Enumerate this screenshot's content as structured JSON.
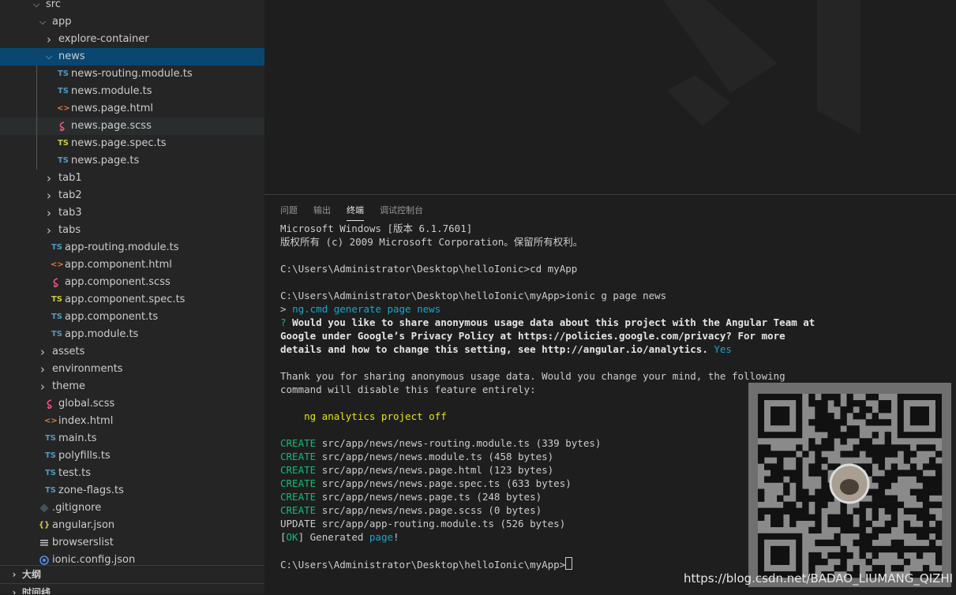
{
  "explorer": {
    "items": [
      {
        "label": "src",
        "type": "folder-open"
      },
      {
        "label": "app",
        "type": "folder-open"
      },
      {
        "label": "explore-container",
        "type": "folder"
      },
      {
        "label": "news",
        "type": "folder-open"
      },
      {
        "label": "news-routing.module.ts",
        "type": "ts-file"
      },
      {
        "label": "news.module.ts",
        "type": "ts-file"
      },
      {
        "label": "news.page.html",
        "type": "html-file"
      },
      {
        "label": "news.page.scss",
        "type": "scss-file"
      },
      {
        "label": "news.page.spec.ts",
        "type": "spec-file"
      },
      {
        "label": "news.page.ts",
        "type": "ts-file"
      },
      {
        "label": "tab1",
        "type": "folder"
      },
      {
        "label": "tab2",
        "type": "folder"
      },
      {
        "label": "tab3",
        "type": "folder"
      },
      {
        "label": "tabs",
        "type": "folder"
      },
      {
        "label": "app-routing.module.ts",
        "type": "ts-file"
      },
      {
        "label": "app.component.html",
        "type": "html-file"
      },
      {
        "label": "app.component.scss",
        "type": "scss-file"
      },
      {
        "label": "app.component.spec.ts",
        "type": "spec-file"
      },
      {
        "label": "app.component.ts",
        "type": "ts-file"
      },
      {
        "label": "app.module.ts",
        "type": "ts-file"
      },
      {
        "label": "assets",
        "type": "folder"
      },
      {
        "label": "environments",
        "type": "folder"
      },
      {
        "label": "theme",
        "type": "folder"
      },
      {
        "label": "global.scss",
        "type": "scss-file"
      },
      {
        "label": "index.html",
        "type": "html-file"
      },
      {
        "label": "main.ts",
        "type": "ts-file"
      },
      {
        "label": "polyfills.ts",
        "type": "ts-file"
      },
      {
        "label": "test.ts",
        "type": "ts-file"
      },
      {
        "label": "zone-flags.ts",
        "type": "ts-file"
      },
      {
        "label": ".gitignore",
        "type": "git-file"
      },
      {
        "label": "angular.json",
        "type": "json-file"
      },
      {
        "label": "browserslist",
        "type": "text-file"
      },
      {
        "label": "ionic.config.json",
        "type": "ionic-file"
      }
    ],
    "icons": {
      "ts": "TS",
      "html": "<>",
      "json": "{}",
      "chevron_right": "›",
      "chevron_down": "⌄"
    },
    "sections": {
      "outline": "大纲",
      "timeline": "时间线"
    }
  },
  "panel": {
    "tabs": [
      {
        "label": "问题"
      },
      {
        "label": "输出"
      },
      {
        "label": "终端"
      },
      {
        "label": "调试控制台"
      }
    ]
  },
  "terminal": {
    "l1": "Microsoft Windows [版本 6.1.7601]",
    "l2": "版权所有 (c) 2009 Microsoft Corporation。保留所有权利。",
    "l4": "C:\\Users\\Administrator\\Desktop\\helloIonic>cd myApp",
    "l6": "C:\\Users\\Administrator\\Desktop\\helloIonic\\myApp>ionic g page news",
    "l7_prefix": "> ",
    "l7_cmd": "ng.cmd generate page news",
    "l8_mark": "? ",
    "l8_text": "Would you like to share anonymous usage data about this project with the Angular Team at",
    "l9_text": "Google under Google’s Privacy Policy at https://policies.google.com/privacy? For more",
    "l10_text": "details and how to change this setting, see http://angular.io/analytics.",
    "l10_answer": " Yes",
    "l12": "Thank you for sharing anonymous usage data. Would you change your mind, the following",
    "l13": "command will disable this feature entirely:",
    "l15": "    ng analytics project off",
    "create_label": "CREATE",
    "update_label": "UPDATE",
    "creates": [
      "src/app/news/news-routing.module.ts (339 bytes)",
      "src/app/news/news.module.ts (458 bytes)",
      "src/app/news/news.page.html (123 bytes)",
      "src/app/news/news.page.spec.ts (633 bytes)",
      "src/app/news/news.page.ts (248 bytes)",
      "src/app/news/news.page.scss (0 bytes)"
    ],
    "update_text": "src/app/app-routing.module.ts (526 bytes)",
    "ok_open": "[",
    "ok_word": "OK",
    "ok_close": "] Generated ",
    "ok_page": "page",
    "ok_end": "!",
    "prompt": "C:\\Users\\Administrator\\Desktop\\helloIonic\\myApp>"
  },
  "watermark": "https://blog.csdn.net/BADAO_LIUMANG_QIZHI",
  "colors": {
    "selected_row": "#094771",
    "green": "#0dbc79",
    "cyan": "#11a8cd",
    "yellow": "#e5e510",
    "ts_blue": "#519aba",
    "html_orange": "#e37933",
    "scss_pink": "#f55385",
    "spec_yellow": "#cbcb41"
  }
}
